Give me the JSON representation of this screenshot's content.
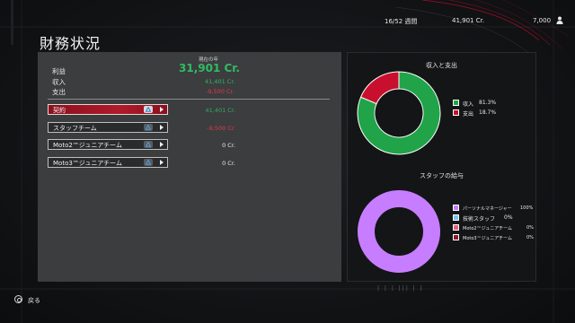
{
  "top_bar": {
    "week": "16/52 週間",
    "money": "41,901 Cr.",
    "fans": "7,000"
  },
  "page_title": "財務状況",
  "summary": {
    "column_header": "現在の年",
    "profit_label": "利益",
    "profit_value": "31,901 Cr.",
    "income_label": "収入",
    "income_value": "41,401 Cr.",
    "expense_label": "支出",
    "expense_value": "-9,500 Cr."
  },
  "rows": [
    {
      "label": "契約",
      "value": "41,401 Cr.",
      "selected": true,
      "tone": "green"
    },
    {
      "label": "スタッフチーム",
      "value": "-9,500 Cr.",
      "selected": false,
      "tone": "red"
    },
    {
      "label": "Moto2™ジュニアチーム",
      "value": "0 Cr.",
      "selected": false,
      "tone": "neutral"
    },
    {
      "label": "Moto3™ジュニアチーム",
      "value": "0 Cr.",
      "selected": false,
      "tone": "neutral"
    }
  ],
  "chart_data": [
    {
      "type": "pie",
      "title": "収入と支出",
      "categories": [
        "収入",
        "支出"
      ],
      "values": [
        81.3,
        18.7
      ],
      "value_labels": [
        "81.3%",
        "18.7%"
      ],
      "colors": [
        "#21a349",
        "#c8102e"
      ],
      "legend": "right"
    },
    {
      "type": "pie",
      "title": "スタッフの給与",
      "categories": [
        "パーソナルマネージャー",
        "技術スタッフ",
        "Moto2™ジュニアチーム",
        "Moto3™ジュニアチーム"
      ],
      "values": [
        100,
        0,
        0,
        0
      ],
      "value_labels": [
        "100%",
        "0%",
        "0%",
        "0%"
      ],
      "colors": [
        "#c77dff",
        "#74c6f2",
        "#e8607a",
        "#8c1a2c"
      ],
      "legend": "right"
    }
  ],
  "footer": {
    "back_label": "戻る",
    "ticks": "|  |  |  |||  |  |"
  }
}
